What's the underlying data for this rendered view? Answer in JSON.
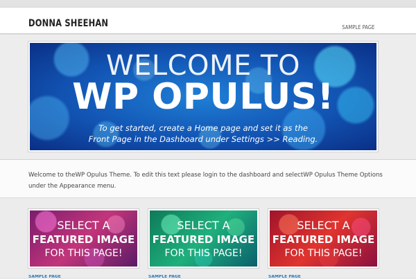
{
  "header": {
    "site_title": "DONNA SHEEHAN",
    "nav": [
      {
        "label": "SAMPLE PAGE"
      }
    ]
  },
  "hero": {
    "line1": "WELCOME TO",
    "line2": "WP OPULUS!",
    "sub_line1": "To get started, create a Home page and set it as the",
    "sub_line2": "Front Page in the Dashboard under Settings >> Reading."
  },
  "intro": {
    "text": "Welcome to theWP Opulus Theme. To edit this text please login to the dashboard and selectWP Opulus Theme Options under the Appearance menu."
  },
  "cards": [
    {
      "line1": "SELECT A",
      "line2": "FEATURED IMAGE",
      "line3": "FOR THIS PAGE!",
      "caption": "SAMPLE PAGE"
    },
    {
      "line1": "SELECT A",
      "line2": "FEATURED IMAGE",
      "line3": "FOR THIS PAGE!",
      "caption": "SAMPLE PAGE"
    },
    {
      "line1": "SELECT A",
      "line2": "FEATURED IMAGE",
      "line3": "FOR THIS PAGE!",
      "caption": "SAMPLE PAGE"
    }
  ],
  "colors": {
    "link": "#2a7ab8",
    "hero_blue": "#1254b3",
    "card1": "#c2357a",
    "card2": "#1fb07c",
    "card3": "#e0342f"
  }
}
